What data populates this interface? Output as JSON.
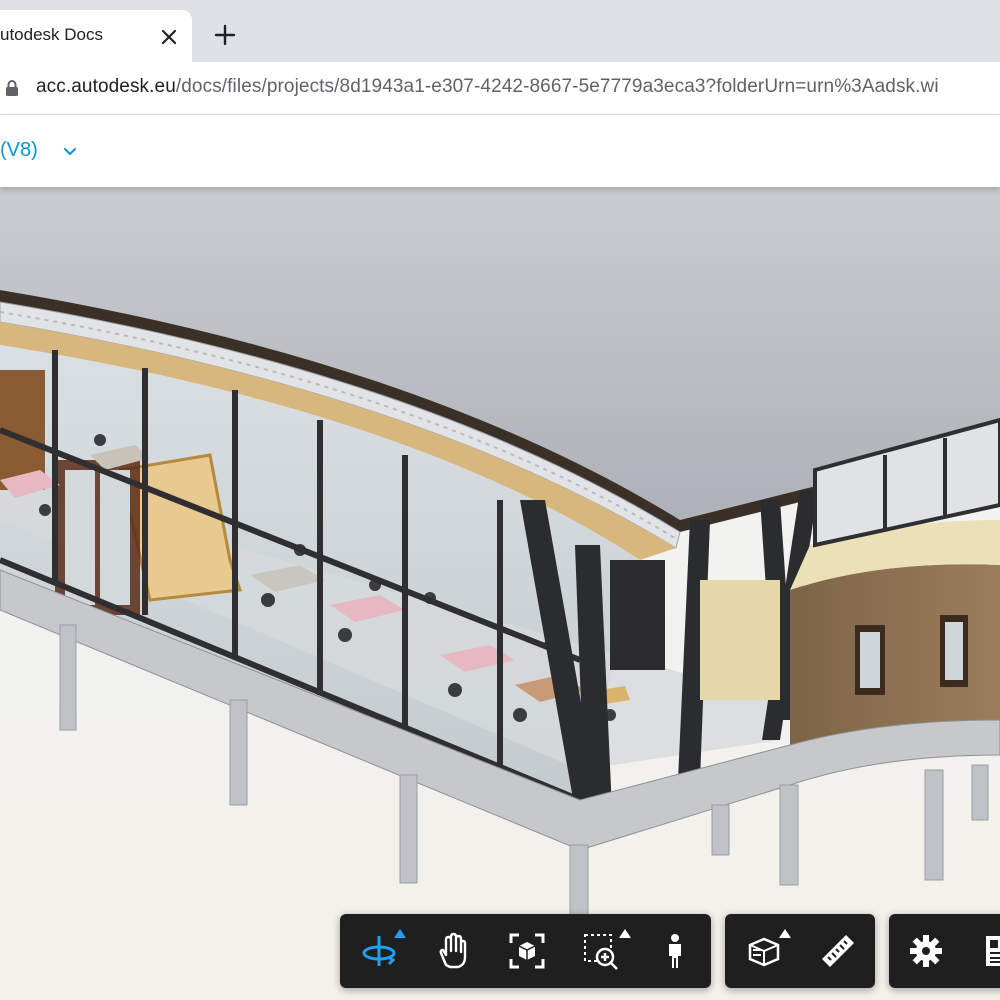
{
  "browser": {
    "tab_title": "utodesk Docs",
    "url_host": "acc.autodesk.eu",
    "url_path": "/docs/files/projects/8d1943a1-e307-4242-8667-5e7779a3eca3?folderUrn=urn%3Aadsk.wi"
  },
  "viewer": {
    "version_label": "(V8)"
  },
  "toolbar": {
    "accent": "#1da1f2",
    "background": "#1f1f1f",
    "groups": [
      [
        "orbit-icon",
        "pan-icon",
        "fit-to-view-icon",
        "zoom-window-icon",
        "first-person-icon"
      ],
      [
        "section-box-icon",
        "measure-icon"
      ],
      [
        "settings-icon",
        "properties-icon"
      ]
    ]
  },
  "scene": {
    "roof_color": "#bfc3c9",
    "wall_color": "#8a6d4e",
    "glass_color": "#cfd6da",
    "frame_color": "#2f2f31"
  }
}
